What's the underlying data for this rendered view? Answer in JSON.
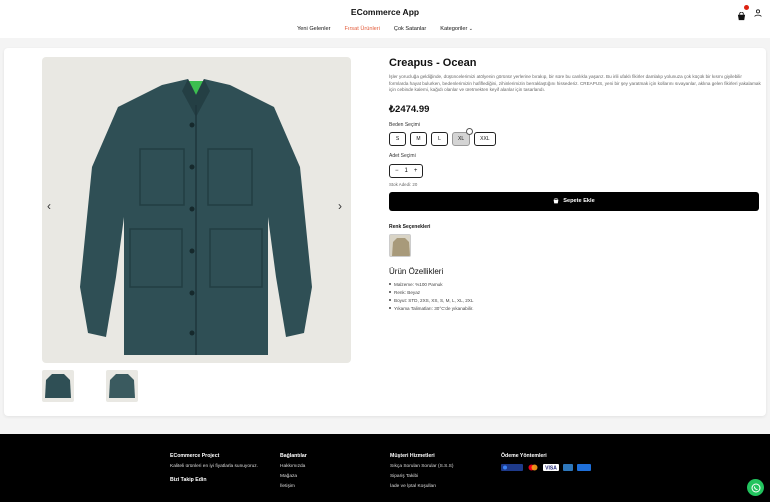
{
  "header": {
    "brand": "ECommerce App",
    "nav": [
      {
        "label": "Yeni Gelenler"
      },
      {
        "label": "Fırsat Ürünleri"
      },
      {
        "label": "Çok Satanlar"
      },
      {
        "label": "Kategoriler"
      }
    ],
    "cart_icon": "shopping-bag-icon",
    "user_icon": "user-icon"
  },
  "product": {
    "title": "Creapus - Ocean",
    "description": "İşler yorucluğa geldiğinde, düşüncelerimizi atölyenin görünür yerlerine bırakıp, bir süre bu canlıkla yaşarız. Bu irili ufaklı fikirler damlalıp yolunuza çok küçük bir kısmı giyilebilir formlarda hayat bulurken, bedenlerimizin hafiflediğini, zihinlerimizin berraklaştığını hissederiz. CREAPUS, yeni bir şey yaratmak için kollarını sıvayanlar, aklına gelen fikirleri yakalamak için cebinde kalemi, kağıdı olanlar ve üretmekten keyif alanlar için tasarlandı.",
    "price": "₺2474.99",
    "size_label": "Beden Seçimi",
    "sizes": [
      "S",
      "M",
      "L",
      "XL",
      "XXL"
    ],
    "selected_size": "XL",
    "qty_label": "Adet Seçimi",
    "qty_minus": "−",
    "qty_value": "1",
    "qty_plus": "+",
    "stock": "Stok Adedi: 20",
    "add_to_cart": "Sepete Ekle",
    "color_title": "Renk Seçenekleri",
    "features_title": "Ürün Özellikleri",
    "features": [
      "Malzeme: %100 Pamuk",
      "Renk: Beyaz",
      "Boyut: STD, 2XS, XS, S, M, L, XL, 2XL",
      "Yıkama Talimatları: 30°C'de yıkanabilir."
    ],
    "arrow_prev": "‹",
    "arrow_next": "›"
  },
  "footer": {
    "col1_title": "ECommerce Project",
    "col1_text": "Kaliteli ürünleri en iyi fiyatlarla sunuyoruz.",
    "col1_follow": "Bizi Takip Edin",
    "col2_title": "Bağlantılar",
    "col2_links": [
      "Hakkımızda",
      "Mağaza",
      "İletişim"
    ],
    "col3_title": "Müşteri Hizmetleri",
    "col3_links": [
      "Sıkça Sorulan Sorular (S.S.S)",
      "Sipariş Takibi",
      "İade ve İptal Koşulları"
    ],
    "col4_title": "Ödeme Yöntemleri",
    "payments": [
      "Troy",
      "Mastercard",
      "VISA",
      "Amex",
      "iyzico"
    ]
  },
  "colors": {
    "accent": "#e35b3a",
    "jacket": "#2f4f55",
    "whatsapp": "#22c35e"
  }
}
